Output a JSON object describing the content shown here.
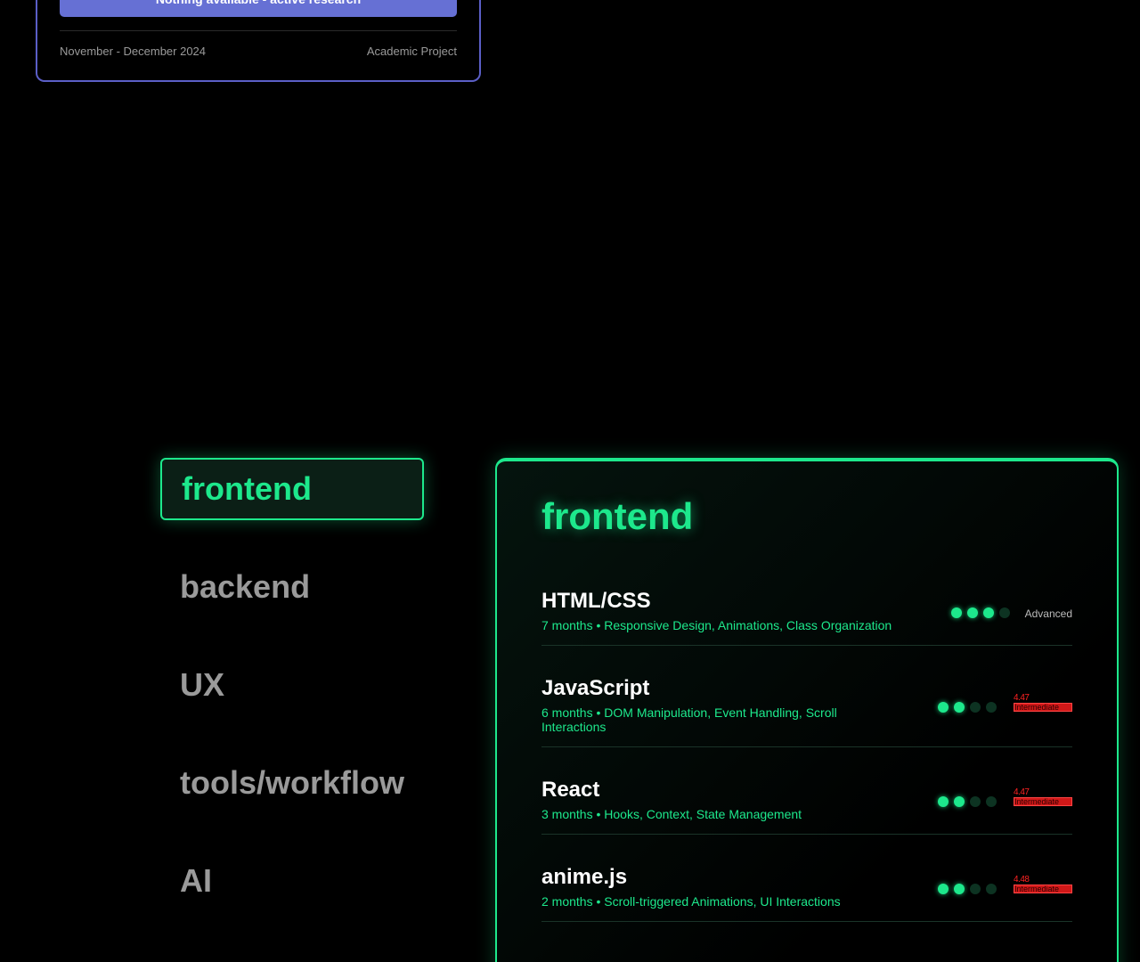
{
  "project": {
    "button_label": "Nothing available - active research",
    "date": "November - December 2024",
    "type": "Academic Project"
  },
  "tabs": [
    "frontend",
    "backend",
    "UX",
    "tools/workflow",
    "AI"
  ],
  "active_tab": "frontend",
  "panel": {
    "title": "frontend",
    "skills": [
      {
        "name": "HTML/CSS",
        "desc": "7 months • Responsive Design, Animations, Class Organization",
        "level": 3,
        "max": 4,
        "level_label": "Advanced"
      },
      {
        "name": "JavaScript",
        "desc": "6 months • DOM Manipulation, Event Handling, Scroll Interactions",
        "level": 2,
        "max": 4,
        "level_num": "4.47",
        "level_label": "Intermediate"
      },
      {
        "name": "React",
        "desc": "3 months • Hooks, Context, State Management",
        "level": 2,
        "max": 4,
        "level_num": "4.47",
        "level_label": "Intermediate"
      },
      {
        "name": "anime.js",
        "desc": "2 months • Scroll-triggered Animations, UI Interactions",
        "level": 2,
        "max": 4,
        "level_num": "4.48",
        "level_label": "Intermediate"
      }
    ]
  },
  "colors": {
    "accent": "#1de88c",
    "project_border": "#5b5fc7",
    "button": "#6670d4",
    "error": "#d01818"
  }
}
